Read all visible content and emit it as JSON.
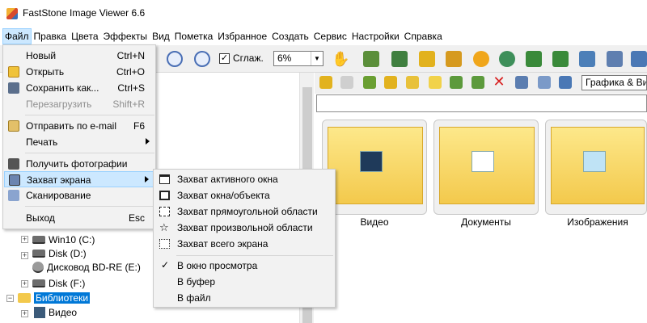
{
  "window": {
    "title": "FastStone Image Viewer 6.6"
  },
  "menubar": [
    "Файл",
    "Правка",
    "Цвета",
    "Эффекты",
    "Вид",
    "Пометка",
    "Избранное",
    "Создать",
    "Сервис",
    "Настройки",
    "Справка"
  ],
  "toolbar": {
    "smooth_label": "Сглаж.",
    "smooth_checked": "✓",
    "zoom_value": "6%",
    "view_mode": "Графика & Ви"
  },
  "file_menu": {
    "items": [
      {
        "label": "Новый",
        "shortcut": "Ctrl+N"
      },
      {
        "label": "Открыть",
        "shortcut": "Ctrl+O"
      },
      {
        "label": "Сохранить как...",
        "shortcut": "Ctrl+S"
      },
      {
        "label": "Перезагрузить",
        "shortcut": "Shift+R"
      },
      {
        "label": "Отправить по e-mail",
        "shortcut": "F6"
      },
      {
        "label": "Печать",
        "shortcut": ""
      },
      {
        "label": "Получить фотографии",
        "shortcut": ""
      },
      {
        "label": "Захват экрана",
        "shortcut": ""
      },
      {
        "label": "Сканирование",
        "shortcut": ""
      },
      {
        "label": "Выход",
        "shortcut": "Esc"
      }
    ]
  },
  "capture_menu": {
    "items": [
      {
        "label": "Захват активного окна"
      },
      {
        "label": "Захват окна/объекта"
      },
      {
        "label": "Захват прямоугольной области"
      },
      {
        "label": "Захват произвольной области"
      },
      {
        "label": "Захват всего экрана"
      },
      {
        "label": "В окно просмотра",
        "check": "✓"
      },
      {
        "label": "В буфер"
      },
      {
        "label": "В файл"
      }
    ]
  },
  "tree": {
    "items": [
      {
        "label": "Win10 (C:)"
      },
      {
        "label": "Disk (D:)"
      },
      {
        "label": "Дисковод BD-RE (E:)"
      },
      {
        "label": "Disk (F:)"
      },
      {
        "label": "Библиотеки"
      },
      {
        "label": "Видео"
      }
    ]
  },
  "thumbnails": [
    {
      "label": "Видео"
    },
    {
      "label": "Документы"
    },
    {
      "label": "Изображения"
    }
  ],
  "colors": {
    "highlight": "#cce8ff",
    "selection": "#0078d7",
    "folder": "#f3c94c"
  }
}
